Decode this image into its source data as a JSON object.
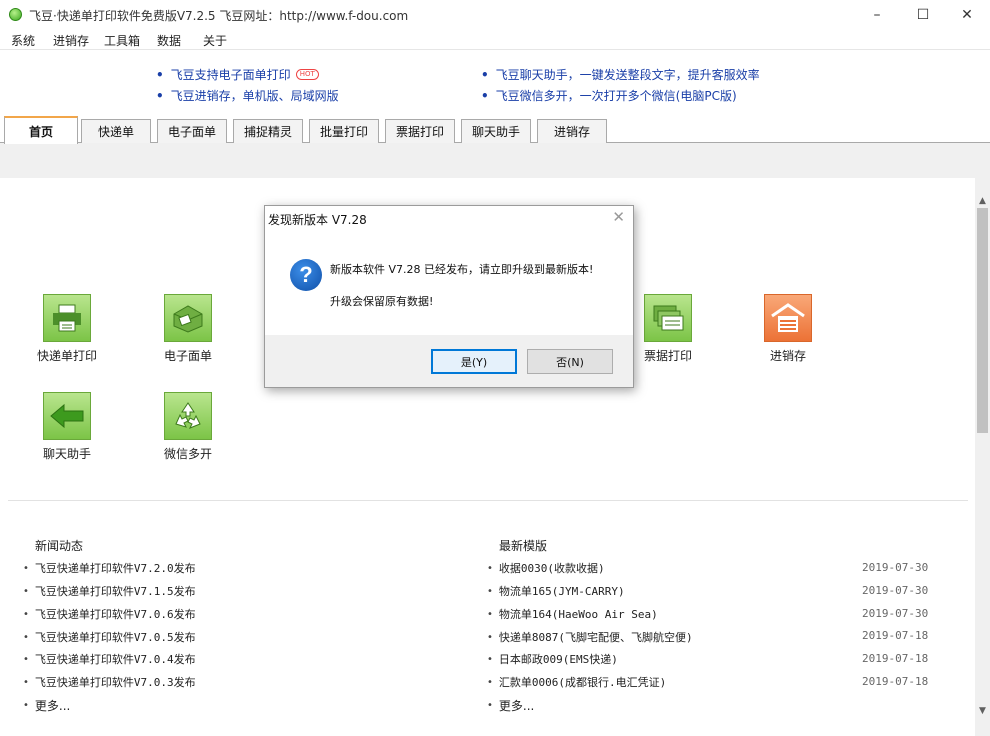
{
  "window": {
    "title": "飞豆·快递单打印软件免费版V7.2.5   飞豆网址：http://www.f-dou.com",
    "minimize": "–",
    "maximize": "☐",
    "close": "✕"
  },
  "menu": [
    "系统",
    "进销存",
    "工具箱",
    "数据",
    "关于"
  ],
  "promos": [
    {
      "text": "飞豆支持电子面单打印",
      "badge": "HOT"
    },
    {
      "text": "飞豆进销存，单机版、局域网版"
    },
    {
      "text": "飞豆聊天助手，一键发送整段文字，提升客服效率"
    },
    {
      "text": "飞豆微信多开，一次打开多个微信(电脑PC版)"
    }
  ],
  "tabs": [
    "首页",
    "快递单",
    "电子面单",
    "捕捉精灵",
    "批量打印",
    "票据打印",
    "聊天助手",
    "进销存"
  ],
  "tiles": [
    {
      "label": "快递单打印",
      "icon": "printer-icon"
    },
    {
      "label": "电子面单",
      "icon": "label-printer-icon"
    },
    {
      "label": "票据打印",
      "icon": "receipts-icon"
    },
    {
      "label": "进销存",
      "icon": "warehouse-icon"
    },
    {
      "label": "聊天助手",
      "icon": "arrow-left-icon"
    },
    {
      "label": "微信多开",
      "icon": "recycle-icon"
    }
  ],
  "news": {
    "title": "新闻动态",
    "items": [
      "飞豆快递单打印软件V7.2.0发布",
      "飞豆快递单打印软件V7.1.5发布",
      "飞豆快递单打印软件V7.0.6发布",
      "飞豆快递单打印软件V7.0.5发布",
      "飞豆快递单打印软件V7.0.4发布",
      "飞豆快递单打印软件V7.0.3发布"
    ],
    "more": "更多..."
  },
  "templates": {
    "title": "最新模版",
    "items": [
      {
        "name": "收据0030(收款收据)",
        "date": "2019-07-30"
      },
      {
        "name": "物流单165(JYM-CARRY)",
        "date": "2019-07-30"
      },
      {
        "name": "物流单164(HaeWoo Air Sea)",
        "date": "2019-07-30"
      },
      {
        "name": "快递单8087(飞脚宅配便、飞脚航空便)",
        "date": "2019-07-18"
      },
      {
        "name": "日本邮政009(EMS快递)",
        "date": "2019-07-18"
      },
      {
        "name": "汇款单0006(成都银行.电汇凭证)",
        "date": "2019-07-18"
      }
    ],
    "more": "更多..."
  },
  "dialog": {
    "title": "发现新版本 V7.28",
    "message1": "新版本软件 V7.28 已经发布，请立即升级到最新版本!",
    "message2": "升级会保留原有数据!",
    "yes": "是(Y)",
    "no": "否(N)",
    "close": "✕"
  }
}
